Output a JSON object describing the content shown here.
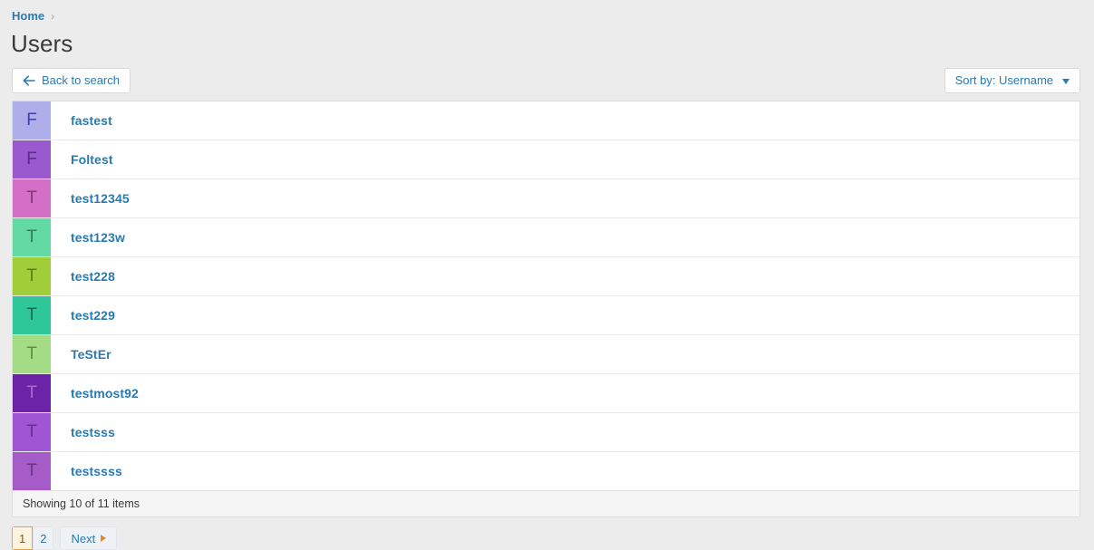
{
  "breadcrumb": {
    "home_label": "Home",
    "separator": "›"
  },
  "page_title": "Users",
  "toolbar": {
    "back_label": "Back to search",
    "back_icon": "arrow-left-icon",
    "sort_label": "Sort by: Username",
    "sort_icon": "caret-down-icon"
  },
  "list": {
    "rows": [
      {
        "initial": "F",
        "username": "fastest",
        "tile_color": "#aeaeea",
        "letter_color": "#3b3bc4"
      },
      {
        "initial": "F",
        "username": "Foltest",
        "tile_color": "#9b59d0",
        "letter_color": "#5c2b85"
      },
      {
        "initial": "T",
        "username": "test12345",
        "tile_color": "#d46fc8",
        "letter_color": "#7d3a76"
      },
      {
        "initial": "T",
        "username": "test123w",
        "tile_color": "#63d9a4",
        "letter_color": "#2f7d5c"
      },
      {
        "initial": "T",
        "username": "test228",
        "tile_color": "#a0ce38",
        "letter_color": "#5e7a1e"
      },
      {
        "initial": "T",
        "username": "test229",
        "tile_color": "#2dc79a",
        "letter_color": "#186b52"
      },
      {
        "initial": "T",
        "username": "TeStEr",
        "tile_color": "#a3dc84",
        "letter_color": "#5f9040"
      },
      {
        "initial": "T",
        "username": "testmost92",
        "tile_color": "#6b24a8",
        "letter_color": "#a56ccc"
      },
      {
        "initial": "T",
        "username": "testsss",
        "tile_color": "#a055d4",
        "letter_color": "#6a2f98"
      },
      {
        "initial": "T",
        "username": "testssss",
        "tile_color": "#a55cc9",
        "letter_color": "#6d3389"
      }
    ],
    "footer_text": "Showing 10 of 11 items"
  },
  "pagination": {
    "pages": [
      "1",
      "2"
    ],
    "active_page": "1",
    "next_label": "Next",
    "next_icon": "triangle-right-icon"
  },
  "colors": {
    "link": "#2a7ab0",
    "page_background": "#ececec",
    "active_page_border": "#e8a33d",
    "next_arrow": "#e8862c"
  }
}
